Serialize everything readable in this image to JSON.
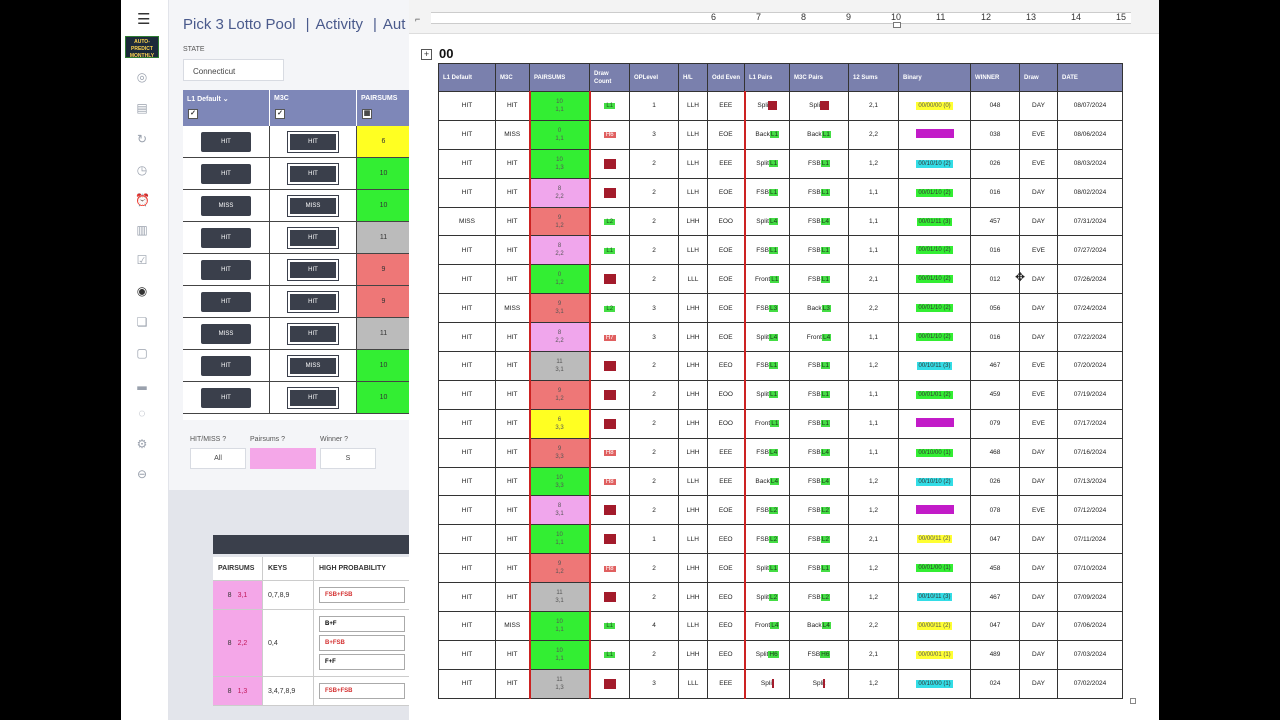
{
  "app": {
    "nav_items": [
      "Pick 3 Lotto Pool",
      "Activity",
      "Aut"
    ],
    "logo_text": "AUTO-PREDICT MONTHLY",
    "state_label": "STATE",
    "state_value": "Connecticut",
    "table_headers": [
      "L1 Default",
      "M3C",
      "PAIRSUMS"
    ],
    "rows": [
      {
        "l1": "HIT",
        "m3c": "HIT",
        "ps": "6",
        "color": "#ffff22"
      },
      {
        "l1": "HIT",
        "m3c": "HIT",
        "ps": "10",
        "color": "#33ee33"
      },
      {
        "l1": "MISS",
        "m3c": "MISS",
        "ps": "10",
        "color": "#33ee33"
      },
      {
        "l1": "HIT",
        "m3c": "HIT",
        "ps": "11",
        "color": "#bbbbbb"
      },
      {
        "l1": "HIT",
        "m3c": "HIT",
        "ps": "9",
        "color": "#ee7777"
      },
      {
        "l1": "HIT",
        "m3c": "HIT",
        "ps": "9",
        "color": "#ee7777"
      },
      {
        "l1": "MISS",
        "m3c": "HIT",
        "ps": "11",
        "color": "#bbbbbb"
      },
      {
        "l1": "HIT",
        "m3c": "MISS",
        "ps": "10",
        "color": "#33ee33"
      },
      {
        "l1": "HIT",
        "m3c": "HIT",
        "ps": "10",
        "color": "#33ee33"
      }
    ],
    "filters": {
      "hitmiss_label": "HIT/MISS ?",
      "hitmiss_value": "All",
      "pairsums_label": "Pairsums ?",
      "winner_label": "Winner ?",
      "winner_value": "S"
    },
    "keys_table": {
      "headers": [
        "PAIRSUMS",
        "KEYS",
        "HIGH PROBABILITY"
      ],
      "rows": [
        {
          "a": "8",
          "b": "3,1",
          "keys": "0,7,8,9",
          "probs": [
            {
              "t": "FSB+FSB",
              "red": true
            }
          ]
        },
        {
          "a": "8",
          "b": "2,2",
          "keys": "0,4",
          "probs": [
            {
              "t": "B+F",
              "red": false
            },
            {
              "t": "B+FSB",
              "red": true
            },
            {
              "t": "F+F",
              "red": false
            }
          ]
        },
        {
          "a": "8",
          "b": "1,3",
          "keys": "3,4,7,8,9",
          "probs": [
            {
              "t": "FSB+FSB",
              "red": true
            }
          ]
        }
      ]
    }
  },
  "doc": {
    "heading": "00",
    "ruler_numbers": [
      "6",
      "7",
      "8",
      "9",
      "10",
      "11",
      "12",
      "13",
      "14",
      "15"
    ],
    "columns": [
      "L1 Default",
      "M3C",
      "PAIRSUMS",
      "Draw Count",
      "OPLevel",
      "H/L",
      "Odd Even",
      "L1 Pairs",
      "M3C Pairs",
      "12 Sums",
      "Binary",
      "WINNER",
      "Draw",
      "DATE"
    ],
    "rows": [
      {
        "l1": "HIT",
        "m3c": "HIT",
        "ps1": "10",
        "ps2": "1,1",
        "psc": "g",
        "dc": "L1",
        "dct": "g",
        "op": "1",
        "hl": "LLH",
        "oe": "EEE",
        "l1p": "Split",
        "l1pt": "sq",
        "m3p": "Split",
        "m3pt": "sq",
        "s12": "2,1",
        "bin": "00/00/00 (0)",
        "bint": "yel",
        "win": "048",
        "wb": false,
        "draw": "DAY",
        "date": "08/07/2024"
      },
      {
        "l1": "HIT",
        "m3c": "MISS",
        "ps1": "0",
        "ps2": "1,1",
        "psc": "g",
        "dc": "H6",
        "dct": "r",
        "op": "3",
        "hl": "LLH",
        "oe": "EOE",
        "l1p": "Back",
        "l1pt": "L1",
        "m3p": "Back",
        "m3pt": "L1",
        "s12": "2,2",
        "bin": "",
        "bint": "mag",
        "win": "038",
        "wb": false,
        "draw": "EVE",
        "date": "08/06/2024"
      },
      {
        "l1": "HIT",
        "m3c": "HIT",
        "ps1": "10",
        "ps2": "1,3",
        "psc": "g",
        "dc": "",
        "dct": "sq",
        "op": "2",
        "hl": "LLH",
        "oe": "EEE",
        "l1p": "Split",
        "l1pt": "L1",
        "m3p": "FSB",
        "m3pt": "L1",
        "s12": "1,2",
        "bin": "00/10/10 (2)",
        "bint": "cya",
        "win": "026",
        "wb": true,
        "draw": "EVE",
        "date": "08/03/2024"
      },
      {
        "l1": "HIT",
        "m3c": "HIT",
        "ps1": "8",
        "ps2": "2,2",
        "psc": "p",
        "dc": "",
        "dct": "sq",
        "op": "2",
        "hl": "LLH",
        "oe": "EOE",
        "l1p": "FSB",
        "l1pt": "L1",
        "m3p": "FSB",
        "m3pt": "L1",
        "s12": "1,1",
        "bin": "00/01/10 (2)",
        "bint": "grn",
        "win": "016",
        "wb": true,
        "draw": "DAY",
        "date": "08/02/2024"
      },
      {
        "l1": "MISS",
        "m3c": "HIT",
        "ps1": "9",
        "ps2": "1,2",
        "psc": "r",
        "dc": "L2",
        "dct": "g",
        "op": "2",
        "hl": "LHH",
        "oe": "EOO",
        "l1p": "Split",
        "l1pt": "L4",
        "m3p": "FSB",
        "m3pt": "L4",
        "s12": "1,1",
        "bin": "00/01/11 (3)",
        "bint": "grn",
        "win": "457",
        "wb": false,
        "draw": "DAY",
        "date": "07/31/2024"
      },
      {
        "l1": "HIT",
        "m3c": "HIT",
        "ps1": "8",
        "ps2": "2,2",
        "psc": "p",
        "dc": "L1",
        "dct": "g",
        "op": "2",
        "hl": "LLH",
        "oe": "EOE",
        "l1p": "FSB",
        "l1pt": "L1",
        "m3p": "FSB",
        "m3pt": "L1",
        "s12": "1,1",
        "bin": "00/01/10 (2)",
        "bint": "grn",
        "win": "016",
        "wb": true,
        "draw": "EVE",
        "date": "07/27/2024"
      },
      {
        "l1": "HIT",
        "m3c": "HIT",
        "ps1": "0",
        "ps2": "1,2",
        "psc": "g",
        "dc": "",
        "dct": "sq",
        "op": "2",
        "hl": "LLL",
        "oe": "EOE",
        "l1p": "Front",
        "l1pt": "L1",
        "m3p": "FSB",
        "m3pt": "L1",
        "s12": "2,1",
        "bin": "00/01/10 (2)",
        "bint": "grn",
        "win": "012",
        "wb": false,
        "draw": "DAY",
        "date": "07/26/2024"
      },
      {
        "l1": "HIT",
        "m3c": "MISS",
        "ps1": "9",
        "ps2": "3,1",
        "psc": "r",
        "dc": "L2",
        "dct": "g",
        "op": "3",
        "hl": "LHH",
        "oe": "EOE",
        "l1p": "FSB",
        "l1pt": "L3",
        "m3p": "Back",
        "m3pt": "L3",
        "s12": "2,2",
        "bin": "00/01/10 (2)",
        "bint": "grn",
        "win": "056",
        "wb": false,
        "draw": "DAY",
        "date": "07/24/2024"
      },
      {
        "l1": "HIT",
        "m3c": "HIT",
        "ps1": "8",
        "ps2": "2,2",
        "psc": "p",
        "dc": "H7",
        "dct": "r",
        "op": "3",
        "hl": "LHH",
        "oe": "EOE",
        "l1p": "Split",
        "l1pt": "L4",
        "m3p": "Front",
        "m3pt": "L4",
        "s12": "1,1",
        "bin": "00/01/10 (2)",
        "bint": "grn",
        "win": "016",
        "wb": true,
        "draw": "DAY",
        "date": "07/22/2024"
      },
      {
        "l1": "HIT",
        "m3c": "HIT",
        "ps1": "11",
        "ps2": "3,1",
        "psc": "s",
        "dc": "",
        "dct": "sq",
        "op": "2",
        "hl": "LHH",
        "oe": "EEO",
        "l1p": "FSB",
        "l1pt": "L1",
        "m3p": "FSB",
        "m3pt": "L1",
        "s12": "1,2",
        "bin": "00/10/11 (3)",
        "bint": "cya",
        "win": "467",
        "wb": false,
        "draw": "EVE",
        "date": "07/20/2024"
      },
      {
        "l1": "HIT",
        "m3c": "HIT",
        "ps1": "9",
        "ps2": "1,2",
        "psc": "r",
        "dc": "",
        "dct": "sq",
        "op": "2",
        "hl": "LHH",
        "oe": "EOO",
        "l1p": "Split",
        "l1pt": "L1",
        "m3p": "FSB",
        "m3pt": "L1",
        "s12": "1,1",
        "bin": "00/01/01 (2)",
        "bint": "grn",
        "win": "459",
        "wb": false,
        "draw": "EVE",
        "date": "07/19/2024"
      },
      {
        "l1": "HIT",
        "m3c": "HIT",
        "ps1": "6",
        "ps2": "3,3",
        "psc": "y",
        "dc": "",
        "dct": "sq",
        "op": "2",
        "hl": "LHH",
        "oe": "EOO",
        "l1p": "Front",
        "l1pt": "L1",
        "m3p": "FSB",
        "m3pt": "L1",
        "s12": "1,1",
        "bin": "",
        "bint": "mag",
        "win": "079",
        "wb": false,
        "draw": "EVE",
        "date": "07/17/2024"
      },
      {
        "l1": "HIT",
        "m3c": "HIT",
        "ps1": "9",
        "ps2": "3,3",
        "psc": "r",
        "dc": "H8",
        "dct": "r",
        "op": "2",
        "hl": "LHH",
        "oe": "EEE",
        "l1p": "FSB",
        "l1pt": "L4",
        "m3p": "FSB",
        "m3pt": "L4",
        "s12": "1,1",
        "bin": "00/10/00 (1)",
        "bint": "grn",
        "win": "468",
        "wb": false,
        "draw": "DAY",
        "date": "07/16/2024"
      },
      {
        "l1": "HIT",
        "m3c": "HIT",
        "ps1": "10",
        "ps2": "3,3",
        "psc": "g",
        "dc": "H8",
        "dct": "r",
        "op": "2",
        "hl": "LLH",
        "oe": "EEE",
        "l1p": "Back",
        "l1pt": "L4",
        "m3p": "FSB",
        "m3pt": "L4",
        "s12": "1,2",
        "bin": "00/10/10 (2)",
        "bint": "cya",
        "win": "026",
        "wb": true,
        "draw": "DAY",
        "date": "07/13/2024"
      },
      {
        "l1": "HIT",
        "m3c": "HIT",
        "ps1": "8",
        "ps2": "3,1",
        "psc": "p",
        "dc": "",
        "dct": "sq",
        "op": "2",
        "hl": "LHH",
        "oe": "EOE",
        "l1p": "FSB",
        "l1pt": "L2",
        "m3p": "FSB",
        "m3pt": "L2",
        "s12": "1,2",
        "bin": "",
        "bint": "mag",
        "win": "078",
        "wb": false,
        "draw": "EVE",
        "date": "07/12/2024"
      },
      {
        "l1": "HIT",
        "m3c": "HIT",
        "ps1": "10",
        "ps2": "1,1",
        "psc": "g",
        "dc": "",
        "dct": "sq",
        "op": "1",
        "hl": "LLH",
        "oe": "EEO",
        "l1p": "FSB",
        "l1pt": "L2",
        "m3p": "FSB",
        "m3pt": "L2",
        "s12": "2,1",
        "bin": "00/00/11 (2)",
        "bint": "yel",
        "win": "047",
        "wb": false,
        "draw": "DAY",
        "date": "07/11/2024"
      },
      {
        "l1": "HIT",
        "m3c": "HIT",
        "ps1": "9",
        "ps2": "1,2",
        "psc": "r",
        "dc": "H8",
        "dct": "r",
        "op": "2",
        "hl": "LHH",
        "oe": "EOE",
        "l1p": "Split",
        "l1pt": "L1",
        "m3p": "FSB",
        "m3pt": "L1",
        "s12": "1,2",
        "bin": "00/01/00 (1)",
        "bint": "grn",
        "win": "458",
        "wb": false,
        "draw": "DAY",
        "date": "07/10/2024"
      },
      {
        "l1": "HIT",
        "m3c": "HIT",
        "ps1": "11",
        "ps2": "3,1",
        "psc": "s",
        "dc": "",
        "dct": "sq",
        "op": "2",
        "hl": "LHH",
        "oe": "EEO",
        "l1p": "Split",
        "l1pt": "L2",
        "m3p": "FSB",
        "m3pt": "L2",
        "s12": "1,2",
        "bin": "00/10/11 (3)",
        "bint": "cya",
        "win": "467",
        "wb": false,
        "draw": "DAY",
        "date": "07/09/2024"
      },
      {
        "l1": "HIT",
        "m3c": "MISS",
        "ps1": "10",
        "ps2": "1,1",
        "psc": "g",
        "dc": "L1",
        "dct": "g",
        "op": "4",
        "hl": "LLH",
        "oe": "EEO",
        "l1p": "Front",
        "l1pt": "L4",
        "m3p": "Back",
        "m3pt": "L4",
        "s12": "2,2",
        "bin": "00/00/11 (2)",
        "bint": "yel",
        "win": "047",
        "wb": false,
        "draw": "DAY",
        "date": "07/06/2024"
      },
      {
        "l1": "HIT",
        "m3c": "HIT",
        "ps1": "10",
        "ps2": "1,1",
        "psc": "g",
        "dc": "L1",
        "dct": "g",
        "op": "2",
        "hl": "LHH",
        "oe": "EEO",
        "l1p": "Split",
        "l1pt": "H6",
        "m3p": "FSB",
        "m3pt": "H6",
        "s12": "2,1",
        "bin": "00/00/01 (1)",
        "bint": "yel",
        "win": "489",
        "wb": false,
        "draw": "DAY",
        "date": "07/03/2024"
      },
      {
        "l1": "HIT",
        "m3c": "HIT",
        "ps1": "11",
        "ps2": "1,3",
        "psc": "s",
        "dc": "",
        "dct": "sq",
        "op": "3",
        "hl": "LLL",
        "oe": "EEE",
        "l1p": "Split",
        "l1pt": "bar",
        "m3p": "Split",
        "m3pt": "bar",
        "s12": "1,2",
        "bin": "00/10/00 (1)",
        "bint": "cya",
        "win": "024",
        "wb": false,
        "draw": "DAY",
        "date": "07/02/2024"
      }
    ]
  }
}
